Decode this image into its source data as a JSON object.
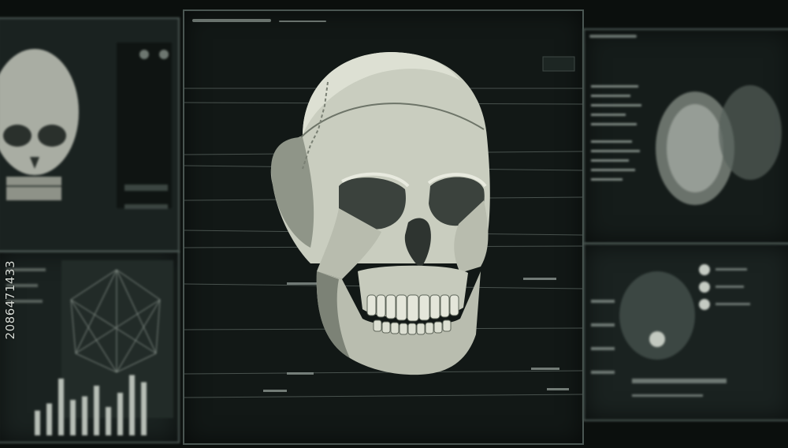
{
  "watermark": {
    "id_text": "2086471433"
  },
  "colors": {
    "bone": "#cfd3c6",
    "bone_shadow": "#6d7468",
    "screen_bg": "#121816",
    "accent": "#9aa49e"
  },
  "left_bar_chart": {
    "values": [
      0.35,
      0.45,
      0.8,
      0.5,
      0.55,
      0.7,
      0.4,
      0.6,
      0.85,
      0.75
    ]
  }
}
